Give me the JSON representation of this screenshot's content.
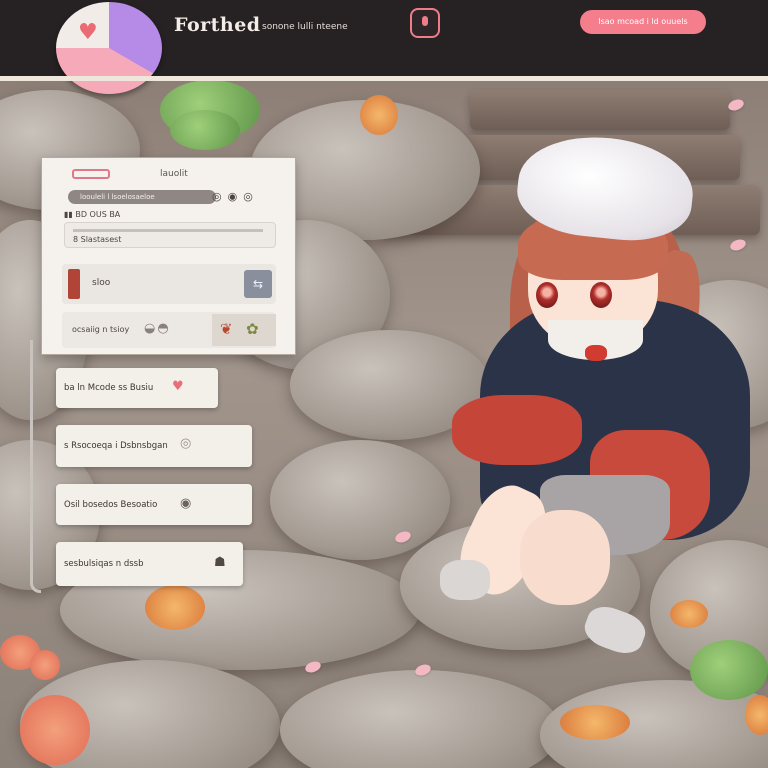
{
  "header": {
    "app_title": "Forthed",
    "subtitle": "sonone lulli nteene",
    "action_button": "lsao mcoad i ld ouuels"
  },
  "panel": {
    "head_label": "lauolit",
    "search_text": "loouleli l lsoelosaeloe",
    "search_icons": "◎◉◎",
    "meta": "▮▮ BD OUS BA",
    "progress_label": "8 Slastasest",
    "item_label": "sloo",
    "item_action_icon": "⇆",
    "footer_label": "ocsaiig n tsioy",
    "footer_icons": "◒◓"
  },
  "cards": [
    {
      "label": "ba ln Mcode ss Busiu",
      "icon": "♥",
      "icon_color": "#e86f76"
    },
    {
      "label": "s Rsocoeqa i Dsbnsbgan",
      "icon": "◎",
      "icon_color": "#9b918c"
    },
    {
      "label": "Osil bosedos Besoatio",
      "icon": "◉",
      "icon_color": "#6b625e"
    },
    {
      "label": "sesbulsiqas n dssb",
      "icon": "☗",
      "icon_color": "#4f4844"
    }
  ],
  "colors": {
    "accent": "#f57e8d",
    "topbar": "#262224",
    "panel": "#f5f2ee"
  }
}
